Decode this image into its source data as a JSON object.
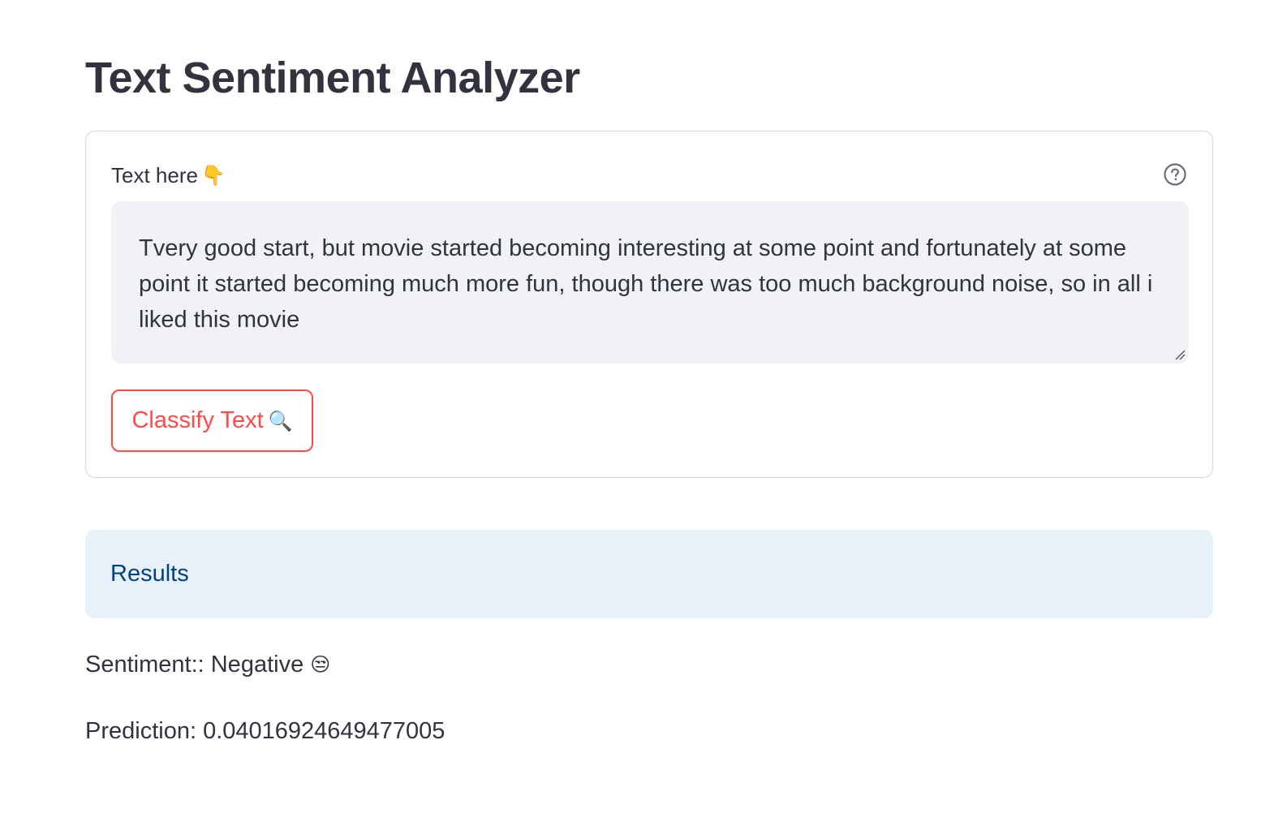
{
  "app": {
    "title": "Text Sentiment Analyzer"
  },
  "form": {
    "label": "Text here",
    "label_emoji": "👇",
    "help_icon": "question-circle-icon",
    "text_value": "Tvery good start, but movie started becoming interesting at some point and fortunately at some point it started becoming much more fun, though there was too much background noise, so in all i liked this movie",
    "button_label": "Classify Text",
    "button_emoji": "🔍"
  },
  "results": {
    "header": "Results",
    "sentiment_label": "Sentiment:: Negative",
    "sentiment_emoji": "😒",
    "prediction_label": "Prediction: 0.04016924649477005"
  },
  "colors": {
    "accent": "#ff4b4b",
    "text": "#31333f",
    "textarea_bg": "#f0f2f6",
    "info_bg": "#e8f0fa",
    "info_text": "#004280"
  }
}
